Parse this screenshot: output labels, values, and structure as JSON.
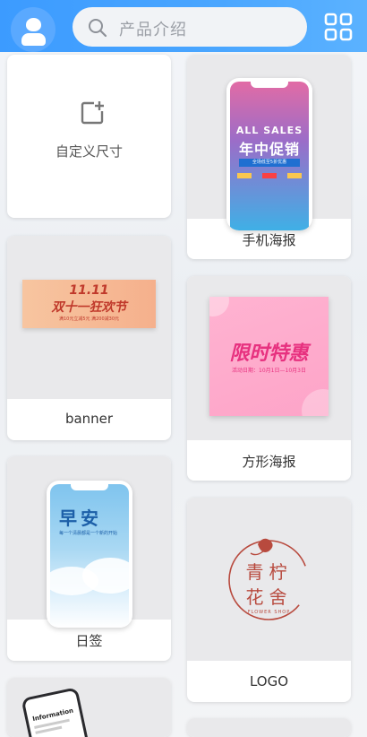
{
  "search": {
    "placeholder": "产品介绍"
  },
  "cards": {
    "custom": {
      "label": "自定义尺寸"
    },
    "phone_poster": {
      "label": "手机海报",
      "title_en": "ALL SALES",
      "title_cn": "年中促销",
      "sub": "全场低至5折优惠"
    },
    "banner": {
      "label": "banner",
      "date": "11.11",
      "title": "双十一狂欢节",
      "sub": "满10元立减5元 满200减30元"
    },
    "square_poster": {
      "label": "方形海报",
      "title": "限时特惠",
      "sub": "活动日期：10月1日—10月3日"
    },
    "daily": {
      "label": "日签",
      "title": "早安",
      "sub": "每一个清晨都是一个新的开始"
    },
    "logo": {
      "label": "LOGO",
      "line1": "青柠",
      "line2": "花舍",
      "sub": "FLOWER SHOP"
    },
    "info": {
      "title": "Information"
    }
  },
  "colors": {
    "topbar": "#3c9bff",
    "poster_pink": "#e7317f",
    "banner_text": "#c0392b",
    "logo_red": "#b84a3e"
  }
}
